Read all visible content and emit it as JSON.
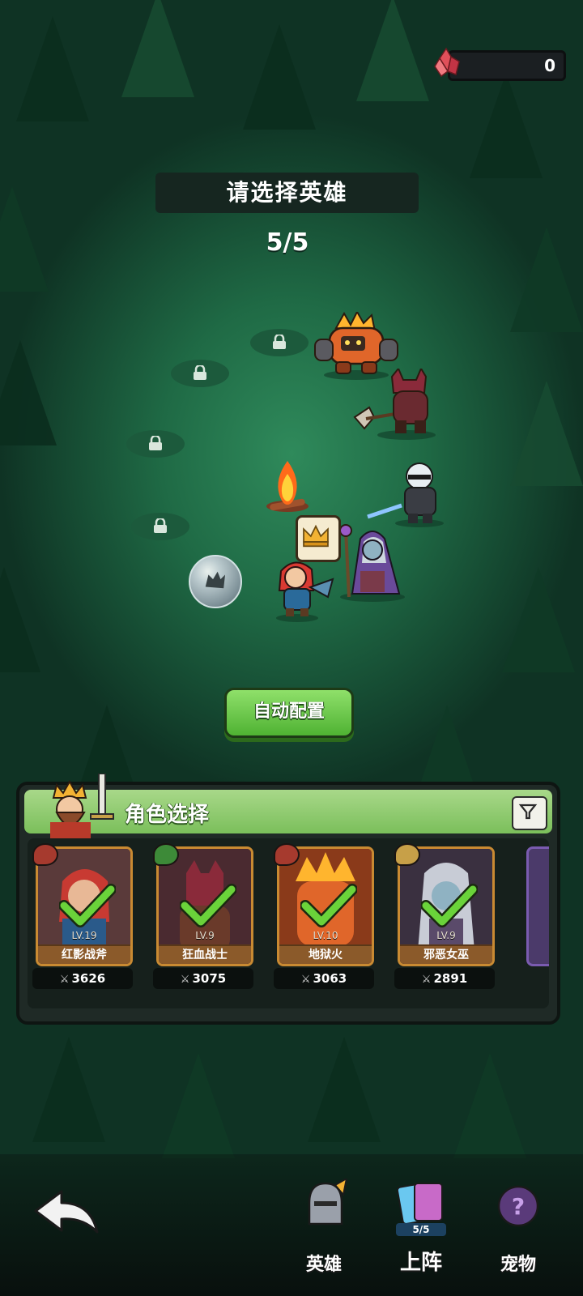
{
  "currency": {
    "amount": "0"
  },
  "header": {
    "title": "请选择英雄",
    "team_count": "5/5"
  },
  "auto_button": {
    "label": "自动配置"
  },
  "panel": {
    "title": "角色选择",
    "heroes": [
      {
        "level": "LV.19",
        "name": "红影战斧",
        "power": "3626",
        "type": "strength",
        "type_color": "#a63a2e",
        "selected": true
      },
      {
        "level": "LV.9",
        "name": "狂血战士",
        "power": "3075",
        "type": "agility",
        "type_color": "#3d8a38",
        "selected": true
      },
      {
        "level": "LV.10",
        "name": "地狱火",
        "power": "3063",
        "type": "strength",
        "type_color": "#a63a2e",
        "selected": true
      },
      {
        "level": "LV.9",
        "name": "邪恶女巫",
        "power": "2891",
        "type": "intellect",
        "type_color": "#c7a048",
        "selected": true
      }
    ]
  },
  "nav": {
    "heroes": "英雄",
    "deploy": "上阵",
    "deploy_count": "5/5",
    "pets": "宠物"
  },
  "colors": {
    "accent_green": "#5fc23c",
    "card_border": "#c98a32",
    "check_green": "#6ad33a"
  }
}
